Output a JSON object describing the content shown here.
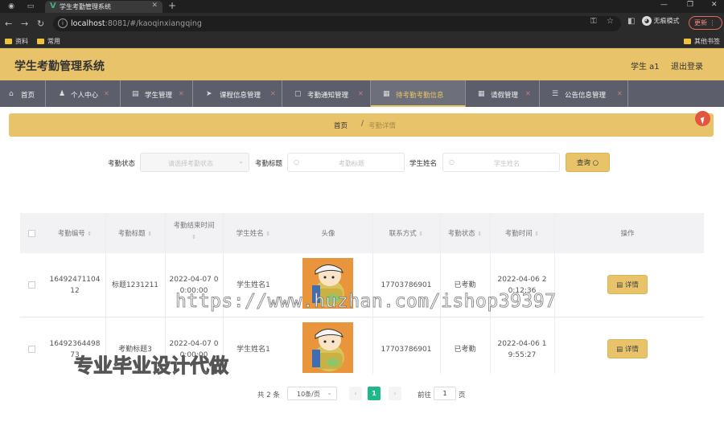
{
  "browser": {
    "tab_title": "学生考勤管理系统",
    "url_host": "localhost",
    "url_path": ":8081/#/kaoqinxiangqing",
    "incognito": "无痕模式",
    "update": "更新",
    "bookmarks": [
      "资料",
      "常用"
    ],
    "other_bookmarks": "其他书签"
  },
  "app": {
    "title": "学生考勤管理系统",
    "user": "学生 a1",
    "logout": "退出登录"
  },
  "menu": [
    {
      "label": "首页",
      "icon": "home-icon"
    },
    {
      "label": "个人中心",
      "icon": "user-icon"
    },
    {
      "label": "学生管理",
      "icon": "chat-icon"
    },
    {
      "label": "课程信息管理",
      "icon": "send-icon"
    },
    {
      "label": "考勤通知管理",
      "icon": "chat-icon"
    },
    {
      "label": "待考勤考勤信息",
      "icon": "doc-icon",
      "active": true
    },
    {
      "label": "请假管理",
      "icon": "doc-icon"
    },
    {
      "label": "公告信息管理",
      "icon": "list-icon"
    }
  ],
  "breadcrumb": {
    "home": "首页",
    "current": "考勤详情"
  },
  "search": {
    "status_label": "考勤状态",
    "status_placeholder": "请选择考勤状态",
    "title_label": "考勤标题",
    "title_placeholder": "考勤标题",
    "name_label": "学生姓名",
    "name_placeholder": "学生姓名",
    "query_button": "查询"
  },
  "table": {
    "headers": {
      "no": "考勤编号",
      "title": "考勤标题",
      "end_time": "考勤结束时间",
      "name": "学生姓名",
      "avatar": "头像",
      "phone": "联系方式",
      "status": "考勤状态",
      "time": "考勤时间",
      "ops": "操作"
    },
    "rows": [
      {
        "no": "1649247110412",
        "title": "标题1231211",
        "end_time": "2022-04-07 00:00:00",
        "name": "学生姓名1",
        "phone": "17703786901",
        "status": "已考勤",
        "time": "2022-04-06 20:12:36",
        "action": "详情"
      },
      {
        "no": "1649236449873",
        "title": "考勤标题3",
        "end_time": "2022-04-07 00:00:00",
        "name": "学生姓名1",
        "phone": "17703786901",
        "status": "已考勤",
        "time": "2022-04-06 19:55:27",
        "action": "详情"
      }
    ]
  },
  "pagination": {
    "total": "共 2 条",
    "page_size": "10条/页",
    "current_page": "1",
    "goto_label": "前往",
    "goto_value": "1",
    "page_unit": "页"
  },
  "watermark": {
    "url": "https://www.huzhan.com/ishop39397",
    "text": "专业毕业设计代做"
  }
}
